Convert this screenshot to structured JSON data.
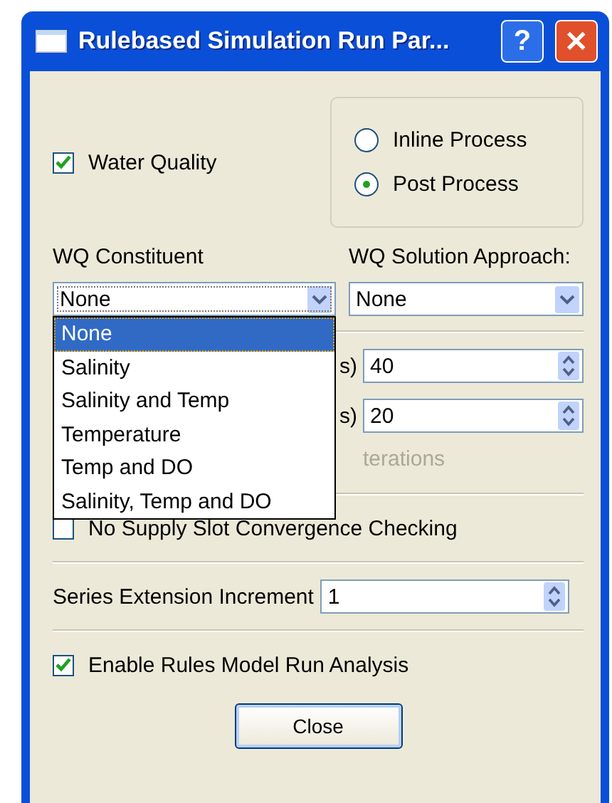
{
  "window": {
    "title": "Rulebased Simulation Run Par...",
    "buttons": [
      {
        "kind": "help",
        "label": "?"
      },
      {
        "kind": "close",
        "label": "✕"
      }
    ]
  },
  "water_quality": {
    "label": "Water Quality",
    "checked": true
  },
  "process": [
    {
      "label": "Inline Process",
      "selected": false
    },
    {
      "label": "Post Process",
      "selected": true
    }
  ],
  "wq_constituent": {
    "label": "WQ Constituent",
    "value": "None",
    "expanded": true,
    "options": [
      {
        "label": "None",
        "selected": true
      },
      {
        "label": "Salinity",
        "selected": false
      },
      {
        "label": "Salinity and Temp",
        "selected": false
      },
      {
        "label": "Temperature",
        "selected": false
      },
      {
        "label": "Temp and DO",
        "selected": false
      },
      {
        "label": "Salinity, Temp and DO",
        "selected": false
      }
    ]
  },
  "wq_solution_approach": {
    "label": "WQ Solution Approach:",
    "value": "None"
  },
  "spin_rows": [
    {
      "label": "s)",
      "value": "40"
    },
    {
      "label": "s)",
      "value": "20"
    }
  ],
  "iterations": {
    "label": "terations",
    "disabled": true
  },
  "no_supply_slot": {
    "label": "No Supply Slot Convergence Checking",
    "checked": false
  },
  "series_extension": {
    "label": "Series Extension Increment",
    "value": "1"
  },
  "enable_analysis": {
    "label": "Enable Rules Model Run Analysis",
    "checked": true
  },
  "close_button": "Close"
}
